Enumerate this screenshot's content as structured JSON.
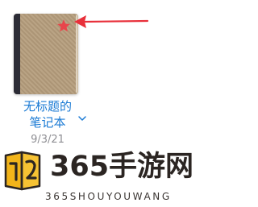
{
  "notebook": {
    "title_line1": "无标题的",
    "title_line2": "笔记本",
    "date": "9/3/21",
    "cover_color": "#b59d7c",
    "spine_color": "#2c2c36",
    "star_color": "#e8454b",
    "title_color": "#1a7ad4",
    "icons": [
      "star-icon",
      "chevron-down-icon"
    ]
  },
  "annotation": {
    "arrow_color": "#e8303a",
    "icon": "arrow-left-icon"
  },
  "watermark": {
    "title": "365手游网",
    "subtitle": "365SHOUYOUWANG"
  }
}
